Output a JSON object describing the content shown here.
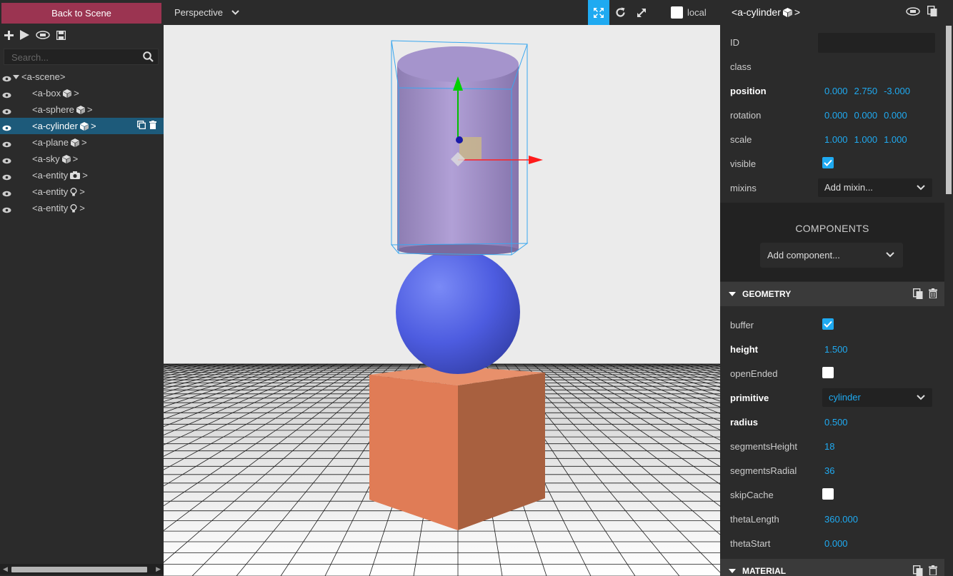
{
  "left": {
    "back_label": "Back to Scene",
    "search_placeholder": "Search...",
    "tree": [
      {
        "label": "<a-scene>",
        "icon": ""
      },
      {
        "label": "<a-box",
        "icon": "cube-icon"
      },
      {
        "label": "<a-sphere",
        "icon": "cube-icon"
      },
      {
        "label": "<a-cylinder",
        "icon": "cube-icon"
      },
      {
        "label": "<a-plane",
        "icon": "cube-icon"
      },
      {
        "label": "<a-sky",
        "icon": "cube-icon"
      },
      {
        "label": "<a-entity",
        "icon": "camera-icon"
      },
      {
        "label": "<a-entity",
        "icon": "lightbulb-icon"
      },
      {
        "label": "<a-entity",
        "icon": "lightbulb-icon"
      }
    ],
    "close_angle": ">"
  },
  "viewport": {
    "camera_label": "Perspective",
    "local_label": "local",
    "accent": "#1faaf1"
  },
  "right": {
    "title": "<a-cylinder",
    "title_close": ">",
    "fields": {
      "id": "ID",
      "class": "class",
      "position": "position",
      "position_values": [
        "0.000",
        "2.750",
        "-3.000"
      ],
      "rotation": "rotation",
      "rotation_values": [
        "0.000",
        "0.000",
        "0.000"
      ],
      "scale": "scale",
      "scale_values": [
        "1.000",
        "1.000",
        "1.000"
      ],
      "visible": "visible",
      "mixins": "mixins",
      "mixins_value": "Add mixin..."
    },
    "components_title": "COMPONENTS",
    "add_component": "Add component...",
    "geometry": {
      "title": "GEOMETRY",
      "buffer": "buffer",
      "height": "height",
      "height_value": "1.500",
      "openEnded": "openEnded",
      "primitive": "primitive",
      "primitive_value": "cylinder",
      "radius": "radius",
      "radius_value": "0.500",
      "segmentsHeight": "segmentsHeight",
      "segmentsHeight_value": "18",
      "segmentsRadial": "segmentsRadial",
      "segmentsRadial_value": "36",
      "skipCache": "skipCache",
      "thetaLength": "thetaLength",
      "thetaLength_value": "360.000",
      "thetaStart": "thetaStart",
      "thetaStart_value": "0.000"
    },
    "material": {
      "title": "MATERIAL"
    }
  },
  "colors": {
    "back_button": "#9b3451",
    "selected_row": "#1d5a7a",
    "value_blue": "#1faaf1",
    "cylinder": "#a592cc",
    "sphere": "#4f5fe0",
    "box": "#e07a56"
  }
}
